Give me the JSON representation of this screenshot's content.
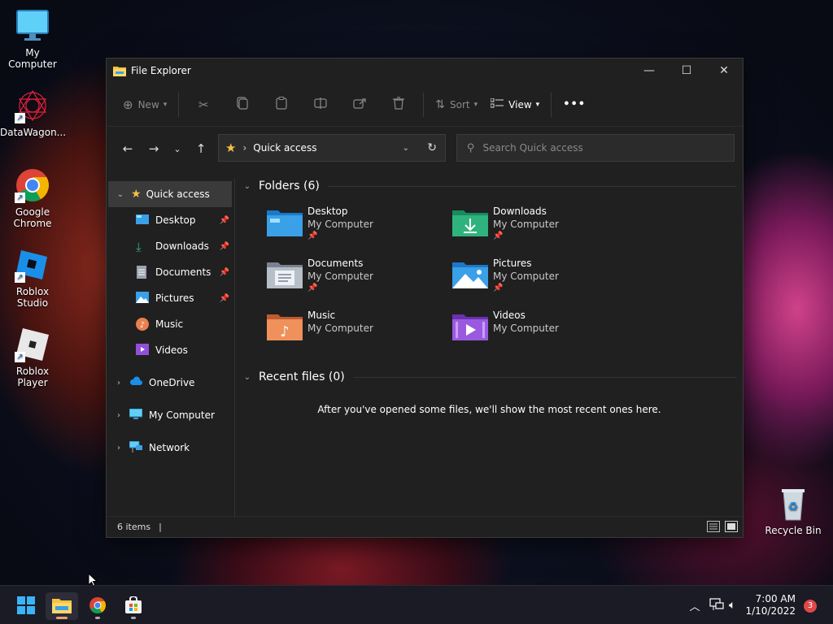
{
  "desktop": {
    "icons": [
      {
        "label": "My Computer",
        "icon": "monitor-icon"
      },
      {
        "label": "DataWagon...",
        "icon": "datawagon-icon"
      },
      {
        "label": "Google Chrome",
        "icon": "chrome-icon"
      },
      {
        "label": "Roblox Studio",
        "icon": "roblox-studio-icon"
      },
      {
        "label": "Roblox Player",
        "icon": "roblox-player-icon"
      }
    ],
    "recycle_bin": {
      "label": "Recycle Bin",
      "icon": "recycle-bin-icon"
    }
  },
  "window": {
    "title": "File Explorer",
    "controls": {
      "minimize": "—",
      "maximize": "☐",
      "close": "✕"
    }
  },
  "toolbar": {
    "new_label": "New",
    "sort_label": "Sort",
    "view_label": "View",
    "more_label": "•••"
  },
  "address": {
    "separator": "›",
    "location": "Quick access"
  },
  "search": {
    "placeholder": "Search Quick access"
  },
  "sidebar": {
    "quick_access": "Quick access",
    "pinned": [
      {
        "label": "Desktop",
        "pinned": true
      },
      {
        "label": "Downloads",
        "pinned": true
      },
      {
        "label": "Documents",
        "pinned": true
      },
      {
        "label": "Pictures",
        "pinned": true
      },
      {
        "label": "Music",
        "pinned": false
      },
      {
        "label": "Videos",
        "pinned": false
      }
    ],
    "roots": [
      "OneDrive",
      "My Computer",
      "Network"
    ]
  },
  "content": {
    "folders_header": "Folders (6)",
    "folders": [
      {
        "name": "Desktop",
        "location": "My Computer",
        "pinned": true,
        "color": "#3aa0e8"
      },
      {
        "name": "Downloads",
        "location": "My Computer",
        "pinned": true,
        "color": "#2fb37e"
      },
      {
        "name": "Documents",
        "location": "My Computer",
        "pinned": true,
        "color": "#9aa3b0"
      },
      {
        "name": "Pictures",
        "location": "My Computer",
        "pinned": true,
        "color": "#3aa0e8"
      },
      {
        "name": "Music",
        "location": "My Computer",
        "pinned": false,
        "color": "#e88050"
      },
      {
        "name": "Videos",
        "location": "My Computer",
        "pinned": false,
        "color": "#9050d8"
      }
    ],
    "recent_header": "Recent files (0)",
    "empty_message": "After you've opened some files, we'll show the most recent ones here."
  },
  "statusbar": {
    "items_text": "6 items",
    "cursor": "|"
  },
  "taskbar": {
    "clock_time": "7:00 AM",
    "clock_date": "1/10/2022",
    "notification_count": "3"
  }
}
